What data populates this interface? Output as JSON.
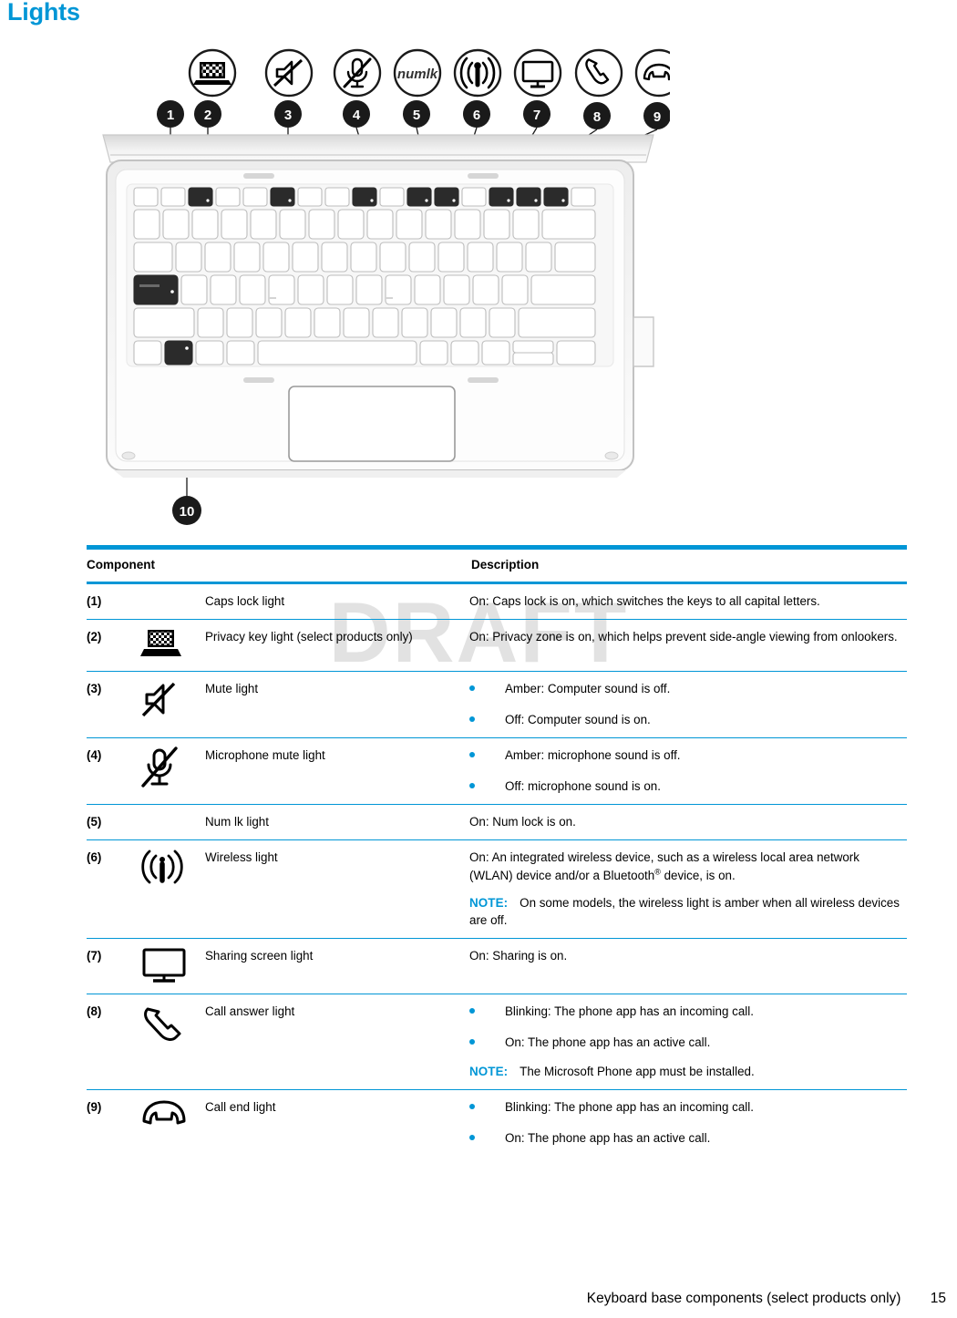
{
  "page": {
    "title": "Lights",
    "watermark": "DRAFT",
    "accent_color": "#0096d6",
    "footer": {
      "text": "Keyboard base components (select products only)",
      "page_number": "15"
    }
  },
  "illustration": {
    "name": "keyboard-base-lights-diagram",
    "legend_icons": [
      {
        "id": "privacy-key-icon",
        "label": "privacy laptop"
      },
      {
        "id": "mute-icon",
        "label": "speaker mute"
      },
      {
        "id": "microphone-mute-icon",
        "label": "microphone mute"
      },
      {
        "id": "numlk-icon",
        "label": "numlk"
      },
      {
        "id": "wireless-icon",
        "label": "wireless"
      },
      {
        "id": "sharing-screen-icon",
        "label": "monitor"
      },
      {
        "id": "call-answer-icon",
        "label": "phone handset"
      },
      {
        "id": "call-end-icon",
        "label": "phone end"
      }
    ],
    "callouts": [
      "1",
      "2",
      "3",
      "4",
      "5",
      "6",
      "7",
      "8",
      "9",
      "10"
    ]
  },
  "table": {
    "headers": {
      "component": "Component",
      "description": "Description"
    },
    "rows": [
      {
        "num": "(1)",
        "icon": "none",
        "name": "Caps lock light",
        "desc_type": "paragraphs",
        "paragraphs": [
          "On: Caps lock is on, which switches the keys to all capital letters."
        ]
      },
      {
        "num": "(2)",
        "icon": "privacy-key-icon",
        "name": "Privacy key light (select products only)",
        "desc_type": "paragraphs",
        "paragraphs": [
          "On: Privacy zone is on, which helps prevent side-angle viewing from onlookers."
        ]
      },
      {
        "num": "(3)",
        "icon": "mute-icon",
        "name": "Mute light",
        "desc_type": "bullets",
        "bullets": [
          "Amber: Computer sound is off.",
          "Off: Computer sound is on."
        ]
      },
      {
        "num": "(4)",
        "icon": "microphone-mute-icon",
        "name": "Microphone mute light",
        "desc_type": "bullets",
        "bullets": [
          "Amber: microphone sound is off.",
          "Off: microphone sound is on."
        ]
      },
      {
        "num": "(5)",
        "icon": "none",
        "name": "Num lk light",
        "desc_type": "paragraphs",
        "paragraphs": [
          "On: Num lock is on."
        ]
      },
      {
        "num": "(6)",
        "icon": "wireless-icon",
        "name": "Wireless light",
        "desc_type": "paragraphs-note",
        "paragraphs": [
          "On: An integrated wireless device, such as a wireless local area network (WLAN) device and/or a Bluetooth® device, is on."
        ],
        "note_label": "NOTE:",
        "note_text": "On some models, the wireless light is amber when all wireless devices are off."
      },
      {
        "num": "(7)",
        "icon": "sharing-screen-icon",
        "name": "Sharing screen light",
        "desc_type": "paragraphs",
        "paragraphs": [
          "On: Sharing is on."
        ]
      },
      {
        "num": "(8)",
        "icon": "call-answer-icon",
        "name": "Call answer light",
        "desc_type": "bullets-note",
        "bullets": [
          "Blinking: The phone app has an incoming call.",
          "On: The phone app has an active call."
        ],
        "note_label": "NOTE:",
        "note_text": "The Microsoft Phone app must be installed."
      },
      {
        "num": "(9)",
        "icon": "call-end-icon",
        "name": "Call end light",
        "desc_type": "bullets",
        "bullets": [
          "Blinking: The phone app has an incoming call.",
          "On: The phone app has an active call."
        ]
      }
    ]
  }
}
